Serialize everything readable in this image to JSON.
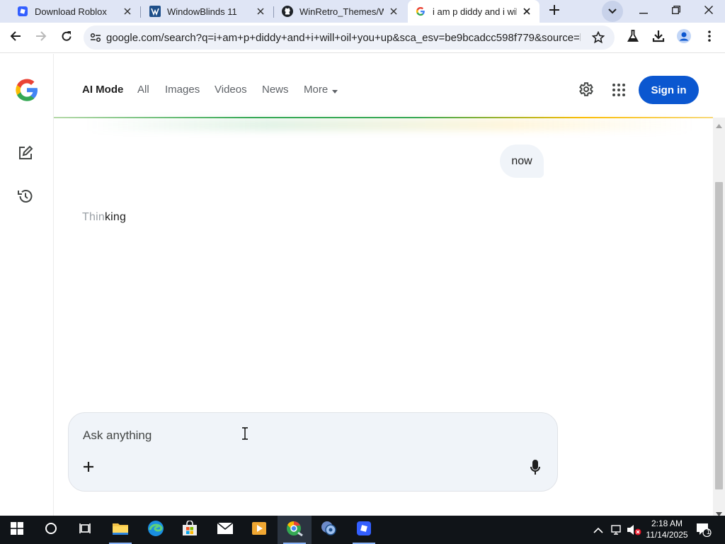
{
  "browser": {
    "tabs": [
      {
        "title": "Download Roblox",
        "favicon": "roblox-icon"
      },
      {
        "title": "WindowBlinds 11",
        "favicon": "windowblinds-icon"
      },
      {
        "title": "WinRetro_Themes/Wi",
        "favicon": "github-icon"
      },
      {
        "title": "i am p diddy and i will",
        "favicon": "google-icon",
        "active": true
      }
    ],
    "url": "google.com/search?q=i+am+p+diddy+and+i+will+oil+you+up&sca_esv=be9bcadcc598f779&source=hp..."
  },
  "page": {
    "nav": {
      "ai_mode": "AI Mode",
      "all": "All",
      "images": "Images",
      "videos": "Videos",
      "news": "News",
      "more": "More",
      "sign_in": "Sign in"
    },
    "chat": {
      "user_message": "now",
      "status_faded": "Thin",
      "status_rest": "king"
    },
    "composer": {
      "placeholder": "Ask anything"
    }
  },
  "taskbar": {
    "time": "2:18 AM",
    "date": "11/14/2025",
    "notification_count": "1",
    "apps": [
      "file-explorer-icon",
      "edge-icon",
      "store-icon",
      "mail-icon",
      "media-player-icon",
      "chrome-icon",
      "windowblinds-icon",
      "roblox-icon"
    ]
  },
  "colors": {
    "accent": "#0b57d0",
    "tab_strip": "#dfe5f5",
    "taskbar": "#101418"
  }
}
